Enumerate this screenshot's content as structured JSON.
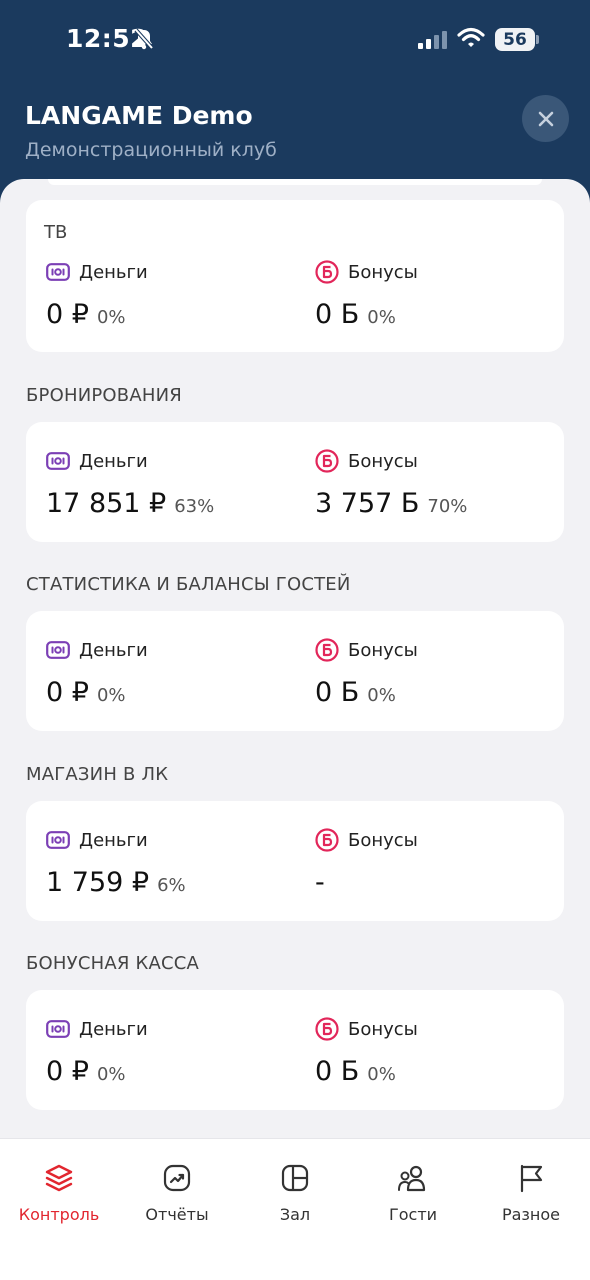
{
  "status_bar": {
    "time": "12:52",
    "battery": "56"
  },
  "header": {
    "title": "LANGAME Demo",
    "subtitle": "Демонстрационный клуб"
  },
  "sections": [
    {
      "title": "ТВ",
      "money": {
        "label": "Деньги",
        "value": "0 ₽",
        "percent": "0%"
      },
      "bonus": {
        "label": "Бонусы",
        "value": "0 Б",
        "percent": "0%"
      }
    },
    {
      "title": "БРОНИРОВАНИЯ",
      "money": {
        "label": "Деньги",
        "value": "17 851 ₽",
        "percent": "63%"
      },
      "bonus": {
        "label": "Бонусы",
        "value": "3 757 Б",
        "percent": "70%"
      }
    },
    {
      "title": "СТАТИСТИКА И БАЛАНСЫ ГОСТЕЙ",
      "money": {
        "label": "Деньги",
        "value": "0 ₽",
        "percent": "0%"
      },
      "bonus": {
        "label": "Бонусы",
        "value": "0 Б",
        "percent": "0%"
      }
    },
    {
      "title": "МАГАЗИН В ЛК",
      "money": {
        "label": "Деньги",
        "value": "1 759 ₽",
        "percent": "6%"
      },
      "bonus": {
        "label": "Бонусы",
        "value": "-",
        "percent": ""
      }
    },
    {
      "title": "БОНУСНАЯ КАССА",
      "money": {
        "label": "Деньги",
        "value": "0 ₽",
        "percent": "0%"
      },
      "bonus": {
        "label": "Бонусы",
        "value": "0 Б",
        "percent": "0%"
      }
    }
  ],
  "tabs": [
    {
      "label": "Контроль",
      "icon": "layers-icon",
      "active": true
    },
    {
      "label": "Отчёты",
      "icon": "reports-icon",
      "active": false
    },
    {
      "label": "Зал",
      "icon": "hall-icon",
      "active": false
    },
    {
      "label": "Гости",
      "icon": "guests-icon",
      "active": false
    },
    {
      "label": "Разное",
      "icon": "flag-icon",
      "active": false
    }
  ],
  "colors": {
    "header_bg": "#1b3a5e",
    "money_icon": "#7b3fb5",
    "bonus_icon": "#e2265a",
    "active_tab": "#e2262f"
  }
}
